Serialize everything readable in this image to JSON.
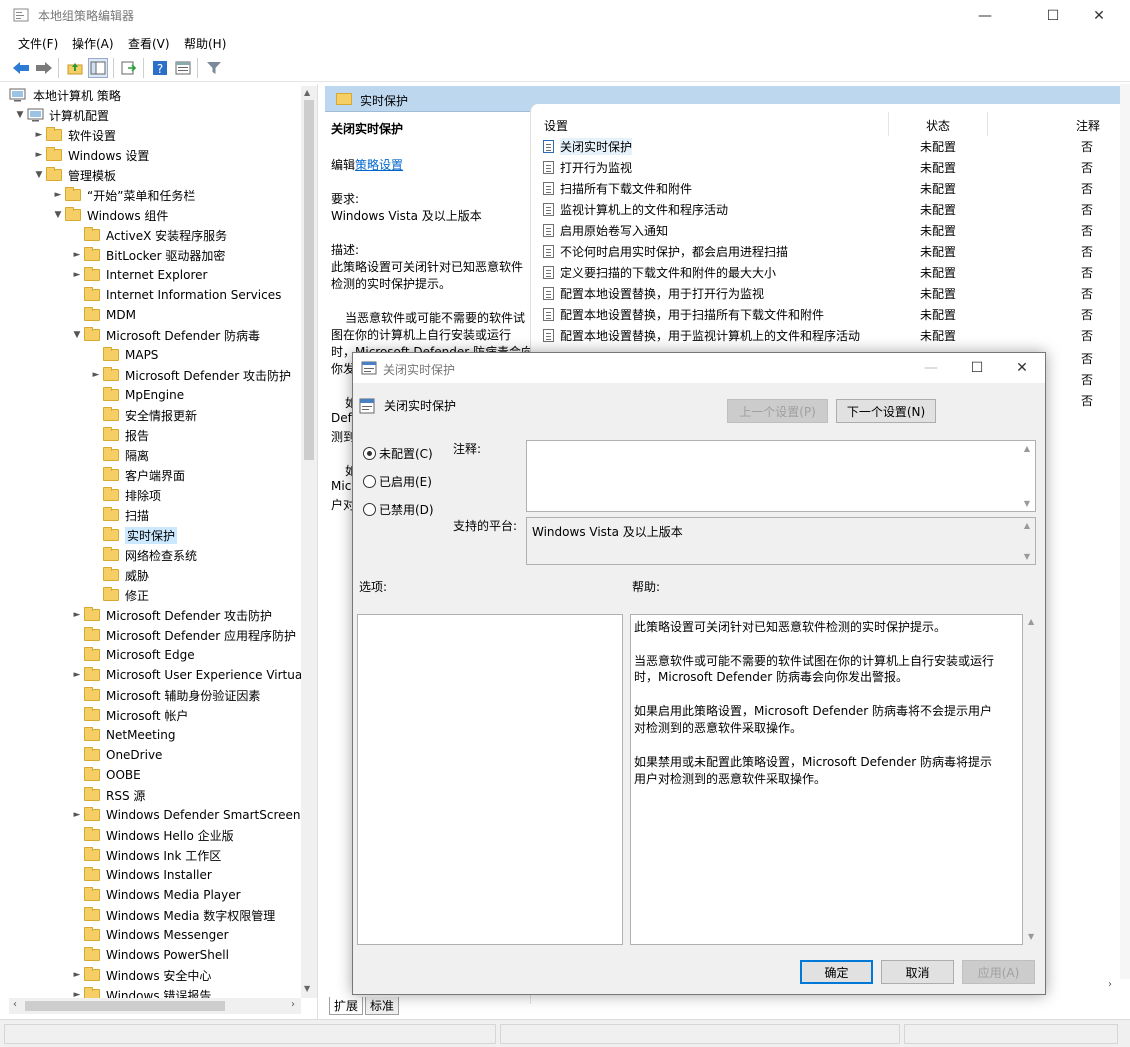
{
  "window": {
    "title": "本地组策略编辑器"
  },
  "menu": [
    "文件(F)",
    "操作(A)",
    "查看(V)",
    "帮助(H)"
  ],
  "tree": {
    "root": "本地计算机 策略",
    "computer_config": "计算机配置",
    "software_settings": "软件设置",
    "windows_settings": "Windows 设置",
    "admin_templates": "管理模板",
    "start_menu": "“开始”菜单和任务栏",
    "windows_components": "Windows 组件",
    "components": [
      "ActiveX 安装程序服务",
      "BitLocker 驱动器加密",
      "Internet Explorer",
      "Internet Information Services",
      "MDM",
      "Microsoft Defender 防病毒"
    ],
    "defender_children": [
      "MAPS",
      "Microsoft Defender 攻击防护",
      "MpEngine",
      "安全情报更新",
      "报告",
      "隔离",
      "客户端界面",
      "排除项",
      "扫描",
      "实时保护",
      "网络检查系统",
      "威胁",
      "修正"
    ],
    "after_defender": [
      "Microsoft Defender 攻击防护",
      "Microsoft Defender 应用程序防护",
      "Microsoft Edge",
      "Microsoft User Experience Virtua",
      "Microsoft 辅助身份验证因素",
      "Microsoft 帐户",
      "NetMeeting",
      "OneDrive",
      "OOBE",
      "RSS 源",
      "Windows Defender SmartScreen",
      "Windows Hello 企业版",
      "Windows Ink 工作区",
      "Windows Installer",
      "Windows Media Player",
      "Windows Media 数字权限管理",
      "Windows Messenger",
      "Windows PowerShell",
      "Windows 安全中心",
      "Windows 错误报告"
    ]
  },
  "right_header": "实时保护",
  "desc": {
    "heading": "关闭实时保护",
    "edit_prefix": "编辑",
    "edit_link": "策略设置",
    "requirement_label": "要求:",
    "requirement_value": "Windows Vista 及以上版本",
    "description_label": "描述:",
    "description_lines": [
      "此策略设置可关闭针对已知恶意软件",
      "检测的实时保护提示。"
    ],
    "para2_lines": [
      "当恶意软件或可能不需要的软件试",
      "图在你的计算机上自行安装或运行",
      "时，Microsoft Defender 防病毒会向",
      "你发"
    ],
    "para3_lines": [
      "如",
      "Defe",
      "测到"
    ],
    "para4_lines": [
      "如",
      "Mic",
      "户对"
    ]
  },
  "settings": {
    "col_setting": "设置",
    "col_state": "状态",
    "col_comment": "注释",
    "rows": [
      {
        "name": "关闭实时保护",
        "state": "未配置",
        "comment": "否"
      },
      {
        "name": "打开行为监视",
        "state": "未配置",
        "comment": "否"
      },
      {
        "name": "扫描所有下载文件和附件",
        "state": "未配置",
        "comment": "否"
      },
      {
        "name": "监视计算机上的文件和程序活动",
        "state": "未配置",
        "comment": "否"
      },
      {
        "name": "启用原始卷写入通知",
        "state": "未配置",
        "comment": "否"
      },
      {
        "name": "不论何时启用实时保护，都会启用进程扫描",
        "state": "未配置",
        "comment": "否"
      },
      {
        "name": "定义要扫描的下载文件和附件的最大大小",
        "state": "未配置",
        "comment": "否"
      },
      {
        "name": "配置本地设置替换，用于打开行为监视",
        "state": "未配置",
        "comment": "否"
      },
      {
        "name": "配置本地设置替换，用于扫描所有下载文件和附件",
        "state": "未配置",
        "comment": "否"
      },
      {
        "name": "配置本地设置替换，用于监视计算机上的文件和程序活动",
        "state": "未配置",
        "comment": "否"
      }
    ],
    "extra_comments": [
      "否",
      "否",
      "否"
    ]
  },
  "tabs": [
    "扩展",
    "标准"
  ],
  "dialog": {
    "title": "关闭实时保护",
    "policy_name": "关闭实时保护",
    "prev_button": "上一个设置(P)",
    "next_button": "下一个设置(N)",
    "radio_not_configured": "未配置(C)",
    "radio_enabled": "已启用(E)",
    "radio_disabled": "已禁用(D)",
    "comment_label": "注释:",
    "platform_label": "支持的平台:",
    "platform_value": "Windows Vista 及以上版本",
    "options_label": "选项:",
    "help_label": "帮助:",
    "help_lines": [
      "此策略设置可关闭针对已知恶意软件检测的实时保护提示。",
      "",
      "    当恶意软件或可能不需要的软件试图在你的计算机上自行安装或运行",
      "时，Microsoft Defender 防病毒会向你发出警报。",
      "",
      "    如果启用此策略设置，Microsoft Defender 防病毒将不会提示用户",
      "对检测到的恶意软件采取操作。",
      "",
      "    如果禁用或未配置此策略设置，Microsoft Defender 防病毒将提示",
      "用户对检测到的恶意软件采取操作。"
    ],
    "ok_button": "确定",
    "cancel_button": "取消",
    "apply_button": "应用(A)"
  },
  "colors": {
    "accent": "#0078d7",
    "header_bg": "#bdd7ee",
    "folder": "#f5cf66"
  }
}
